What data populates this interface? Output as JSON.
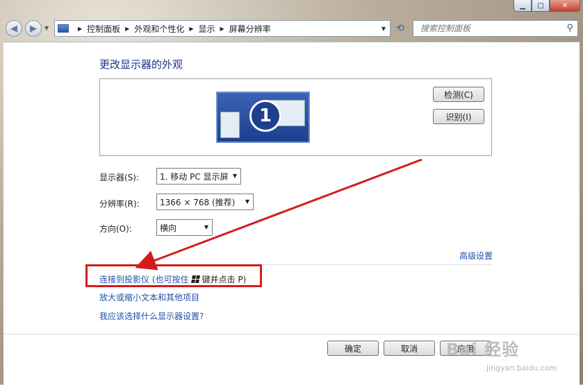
{
  "window": {
    "min_glyph": "▁",
    "max_glyph": "□",
    "close_glyph": "✕"
  },
  "nav": {
    "back_glyph": "◀",
    "forward_glyph": "▶",
    "breadcrumbs": [
      "控制面板",
      "外观和个性化",
      "显示",
      "屏幕分辨率"
    ],
    "search_placeholder": "搜索控制面板"
  },
  "page": {
    "title": "更改显示器的外观",
    "monitor_number": "1",
    "detect_button": "检测(C)",
    "identify_button": "识别(I)"
  },
  "settings": {
    "display_label": "显示器(S):",
    "display_value": "1. 移动 PC 显示屏",
    "resolution_label": "分辨率(R):",
    "resolution_value": "1366 × 768 (推荐)",
    "orientation_label": "方向(O):",
    "orientation_value": "横向"
  },
  "links": {
    "advanced": "高级设置",
    "projector_pre": "连接到投影仪 (也可按住",
    "projector_post": "键并点击 P)",
    "text_size": "放大或缩小文本和其他项目",
    "help": "我应该选择什么显示器设置?"
  },
  "buttons": {
    "ok": "确定",
    "cancel": "取消",
    "apply": "应用"
  },
  "watermark": {
    "brand": "Bai 经验",
    "url": "jingyan.baidu.com"
  },
  "colors": {
    "link": "#1e50a8",
    "title": "#1e3287",
    "annotation": "#d21c1c"
  }
}
